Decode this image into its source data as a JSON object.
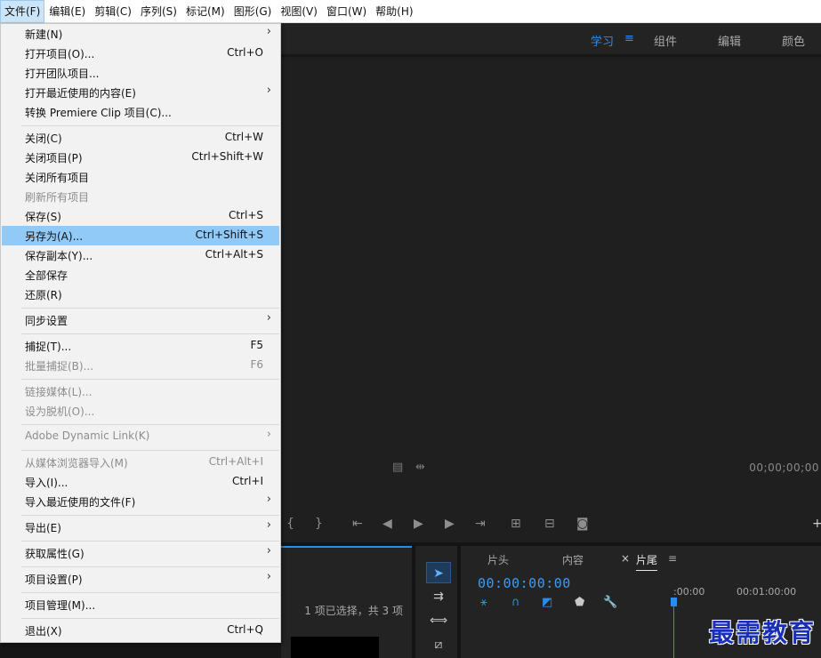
{
  "menubar": {
    "items": [
      "文件(F)",
      "编辑(E)",
      "剪辑(C)",
      "序列(S)",
      "标记(M)",
      "图形(G)",
      "视图(V)",
      "窗口(W)",
      "帮助(H)"
    ]
  },
  "workspaces": {
    "tabs": [
      "学习",
      "组件",
      "编辑",
      "颜色"
    ],
    "menu_icon": "≡"
  },
  "monitor": {
    "timecode": "00;00;00;00"
  },
  "file_menu": {
    "items": [
      {
        "label": "新建(N)",
        "shortcut": "",
        "submenu": true,
        "disabled": false
      },
      {
        "label": "打开项目(O)...",
        "shortcut": "Ctrl+O",
        "submenu": false,
        "disabled": false
      },
      {
        "label": "打开团队项目...",
        "shortcut": "",
        "submenu": false,
        "disabled": false
      },
      {
        "label": "打开最近使用的内容(E)",
        "shortcut": "",
        "submenu": true,
        "disabled": false
      },
      {
        "label": "转换 Premiere Clip 项目(C)...",
        "shortcut": "",
        "submenu": false,
        "disabled": false
      },
      {
        "label": "关闭(C)",
        "shortcut": "Ctrl+W",
        "submenu": false,
        "disabled": false
      },
      {
        "label": "关闭项目(P)",
        "shortcut": "Ctrl+Shift+W",
        "submenu": false,
        "disabled": false
      },
      {
        "label": "关闭所有项目",
        "shortcut": "",
        "submenu": false,
        "disabled": false
      },
      {
        "label": "刷新所有项目",
        "shortcut": "",
        "submenu": false,
        "disabled": true
      },
      {
        "label": "保存(S)",
        "shortcut": "Ctrl+S",
        "submenu": false,
        "disabled": false
      },
      {
        "label": "另存为(A)...",
        "shortcut": "Ctrl+Shift+S",
        "submenu": false,
        "disabled": false,
        "highlighted": true
      },
      {
        "label": "保存副本(Y)...",
        "shortcut": "Ctrl+Alt+S",
        "submenu": false,
        "disabled": false
      },
      {
        "label": "全部保存",
        "shortcut": "",
        "submenu": false,
        "disabled": false
      },
      {
        "label": "还原(R)",
        "shortcut": "",
        "submenu": false,
        "disabled": false
      },
      {
        "label": "同步设置",
        "shortcut": "",
        "submenu": true,
        "disabled": false
      },
      {
        "label": "捕捉(T)...",
        "shortcut": "F5",
        "submenu": false,
        "disabled": false
      },
      {
        "label": "批量捕捉(B)...",
        "shortcut": "F6",
        "submenu": false,
        "disabled": true
      },
      {
        "label": "链接媒体(L)...",
        "shortcut": "",
        "submenu": false,
        "disabled": true
      },
      {
        "label": "设为脱机(O)...",
        "shortcut": "",
        "submenu": false,
        "disabled": true
      },
      {
        "label": "Adobe Dynamic Link(K)",
        "shortcut": "",
        "submenu": true,
        "disabled": true
      },
      {
        "label": "从媒体浏览器导入(M)",
        "shortcut": "Ctrl+Alt+I",
        "submenu": false,
        "disabled": true
      },
      {
        "label": "导入(I)...",
        "shortcut": "Ctrl+I",
        "submenu": false,
        "disabled": false
      },
      {
        "label": "导入最近使用的文件(F)",
        "shortcut": "",
        "submenu": true,
        "disabled": false
      },
      {
        "label": "导出(E)",
        "shortcut": "",
        "submenu": true,
        "disabled": false
      },
      {
        "label": "获取属性(G)",
        "shortcut": "",
        "submenu": true,
        "disabled": false
      },
      {
        "label": "项目设置(P)",
        "shortcut": "",
        "submenu": true,
        "disabled": false
      },
      {
        "label": "项目管理(M)...",
        "shortcut": "",
        "submenu": false,
        "disabled": false
      },
      {
        "label": "退出(X)",
        "shortcut": "Ctrl+Q",
        "submenu": false,
        "disabled": false
      }
    ]
  },
  "project_panel": {
    "status": "1 项已选择，共 3 项"
  },
  "timeline": {
    "tabs": [
      "片头",
      "内容",
      "片尾"
    ],
    "active_tab": "片尾",
    "close_icon": "×",
    "menu_icon": "≡",
    "timecode": "00:00:00:00",
    "ruler_labels": [
      ":00:00",
      "00:01:00:00"
    ]
  },
  "watermark": {
    "text": "最需教育"
  },
  "colors": {
    "accent": "#2d8ceb",
    "menu_highlight": "#91c9f7",
    "panel_bg": "#232323"
  }
}
